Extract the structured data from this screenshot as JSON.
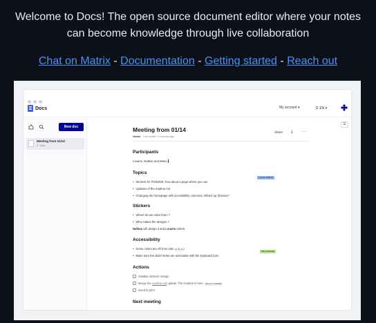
{
  "welcome": {
    "line1": "Welcome to Docs! The open source document editor where your notes",
    "line2": "can become knowledge through live collaboration"
  },
  "links": {
    "matrix": "Chat on Matrix",
    "documentation": "Documentation",
    "getting_started": "Getting started",
    "reach_out": "Reach out",
    "separator": "-"
  },
  "app": {
    "logo_text": "Docs",
    "account": "My account ▾",
    "language": "EN ▾",
    "new_doc": "New doc",
    "sidebar_doc": {
      "title": "Meeting from 01/14",
      "subtitle": "2 · Now"
    },
    "toc_icon": "list-icon"
  },
  "doc": {
    "title": "Meeting from 01/14",
    "meta_owner": "Owner",
    "meta_rest": " · Last update: 9 seconds ago",
    "share": "Share",
    "participants_h": "Participants",
    "participants": "Louane, Nathan and Manu",
    "topics_h": "Topics",
    "topics": [
      "Stickers for FOSDEM, how about a page where you can",
      "Updates of the readme.md",
      "Changing the homepage with accessibility concerns. What's up @manu?"
    ],
    "cursor_louane": "Louane Ollando",
    "stickers_h": "Stickers",
    "stickers": [
      "Where do we order them ?",
      "Who makes the designs ?"
    ],
    "stickers_p_name1": "Nathan",
    "stickers_p_mid": " will design it and ",
    "stickers_p_name2": "Louane",
    "stickers_p_end": " orders.",
    "accessibility_h": "Accessibility",
    "a11y_1": "Some colors are off (min ratio ",
    "a11y_1_code": "4.5:1",
    "a11y_1_end": ")",
    "a11y_2": "Make sure the slider items are actionable with the keyboard (use",
    "cursor_manu": "Manu Pelletier",
    "actions_h": "Actions",
    "action_1": "Validate stickers' design",
    "action_2_a": "Merge the ",
    "action_2_link": "readme.md",
    "action_2_b": " update. The readme is here: ",
    "action_2_code": "docs/readme",
    "action_3": "Send to print",
    "next_h": "Next meeting"
  },
  "colors": {
    "accent": "#000091",
    "link": "#4493f8",
    "bg": "#0d1117",
    "cursor_louane": "#8fb8f5",
    "cursor_manu": "#b5e28b"
  }
}
